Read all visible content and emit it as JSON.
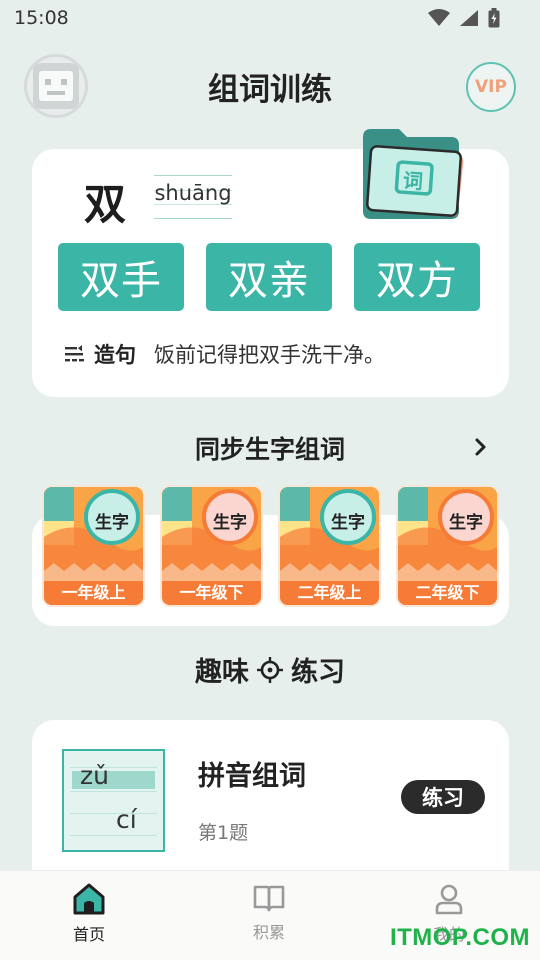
{
  "status_bar": {
    "time": "15:08",
    "icons": [
      "wifi-icon",
      "signal-icon",
      "battery-icon"
    ]
  },
  "header": {
    "title": "组词训练",
    "vip_label": "VIP"
  },
  "word_card": {
    "character": "双",
    "pinyin": "shuāng",
    "words": [
      "双手",
      "双亲",
      "双方"
    ],
    "sentence_label": "造句",
    "sentence": "饭前记得把双手洗干净。"
  },
  "sync_section": {
    "title": "同步生字组词",
    "seal_text": "生字",
    "grades": [
      "一年级上",
      "一年级下",
      "二年级上",
      "二年级下"
    ]
  },
  "fun_section": {
    "title_left": "趣味",
    "title_right": "练习"
  },
  "practice": {
    "thumb_word1": "zǔ",
    "thumb_word2": "cí",
    "title": "拼音组词",
    "subtitle": "第1题",
    "button_label": "练习"
  },
  "bottom_nav": {
    "home": "首页",
    "accumulate": "积累",
    "mine": "我的"
  },
  "watermark": "ITMOP.COM",
  "colors": {
    "accent": "#3bb5a6",
    "orange": "#f57b37",
    "background": "#e6efec",
    "watermark": "#1fb24a"
  }
}
